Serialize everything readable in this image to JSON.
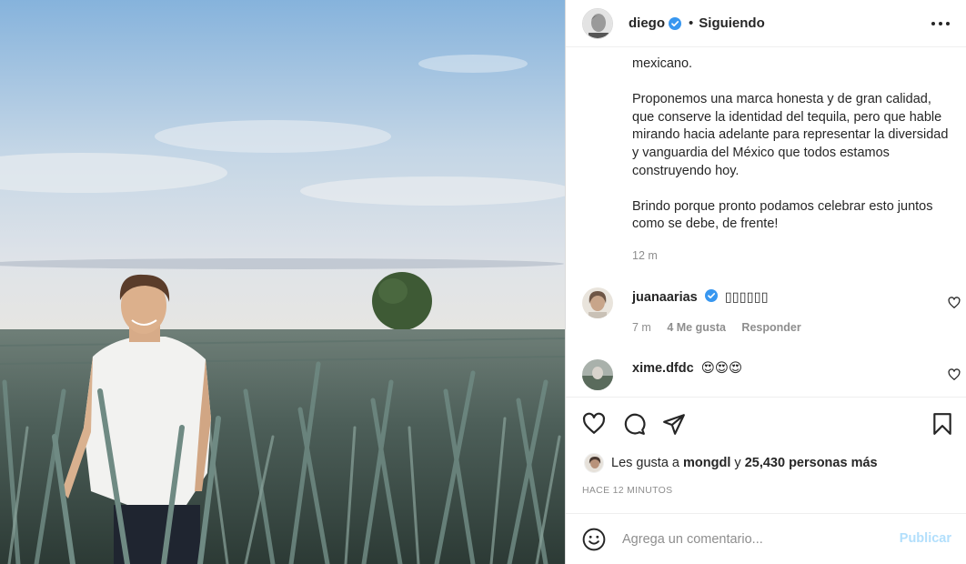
{
  "post": {
    "author": "diego",
    "verified": true,
    "dot": "•",
    "follow_status": "Siguiendo",
    "caption": [
      "mexicano.",
      "Proponemos una marca honesta y de gran calidad, que conserve la identidad del tequila, pero que hable mirando hacia adelante para representar la diversidad y vanguardia del México que todos estamos construyendo hoy.",
      "Brindo porque pronto podamos celebrar esto juntos como se debe, de frente!"
    ],
    "caption_time": "12 m"
  },
  "comments": [
    {
      "user": "juanaarias",
      "verified": true,
      "text": "▯▯▯▯▯▯",
      "time": "7 m",
      "likes": "4 Me gusta",
      "reply": "Responder"
    },
    {
      "user": "xime.dfdc",
      "verified": false,
      "text": "😍😍😍"
    }
  ],
  "likes": {
    "prefix": "Les gusta a",
    "user": "mongdl",
    "middle": "y",
    "count_text": "25,430 personas más"
  },
  "timestamp": "HACE 12 MINUTOS",
  "composer": {
    "placeholder": "Agrega un comentario...",
    "publish_label": "Publicar"
  },
  "colors": {
    "verified_blue": "#3897f0",
    "publish_disabled": "#b2dffc",
    "secondary_text": "#8e8e8e"
  },
  "icons": [
    "heart-icon",
    "comment-icon",
    "share-icon",
    "bookmark-icon",
    "more-icon",
    "emoji-icon",
    "verified-badge-icon"
  ]
}
